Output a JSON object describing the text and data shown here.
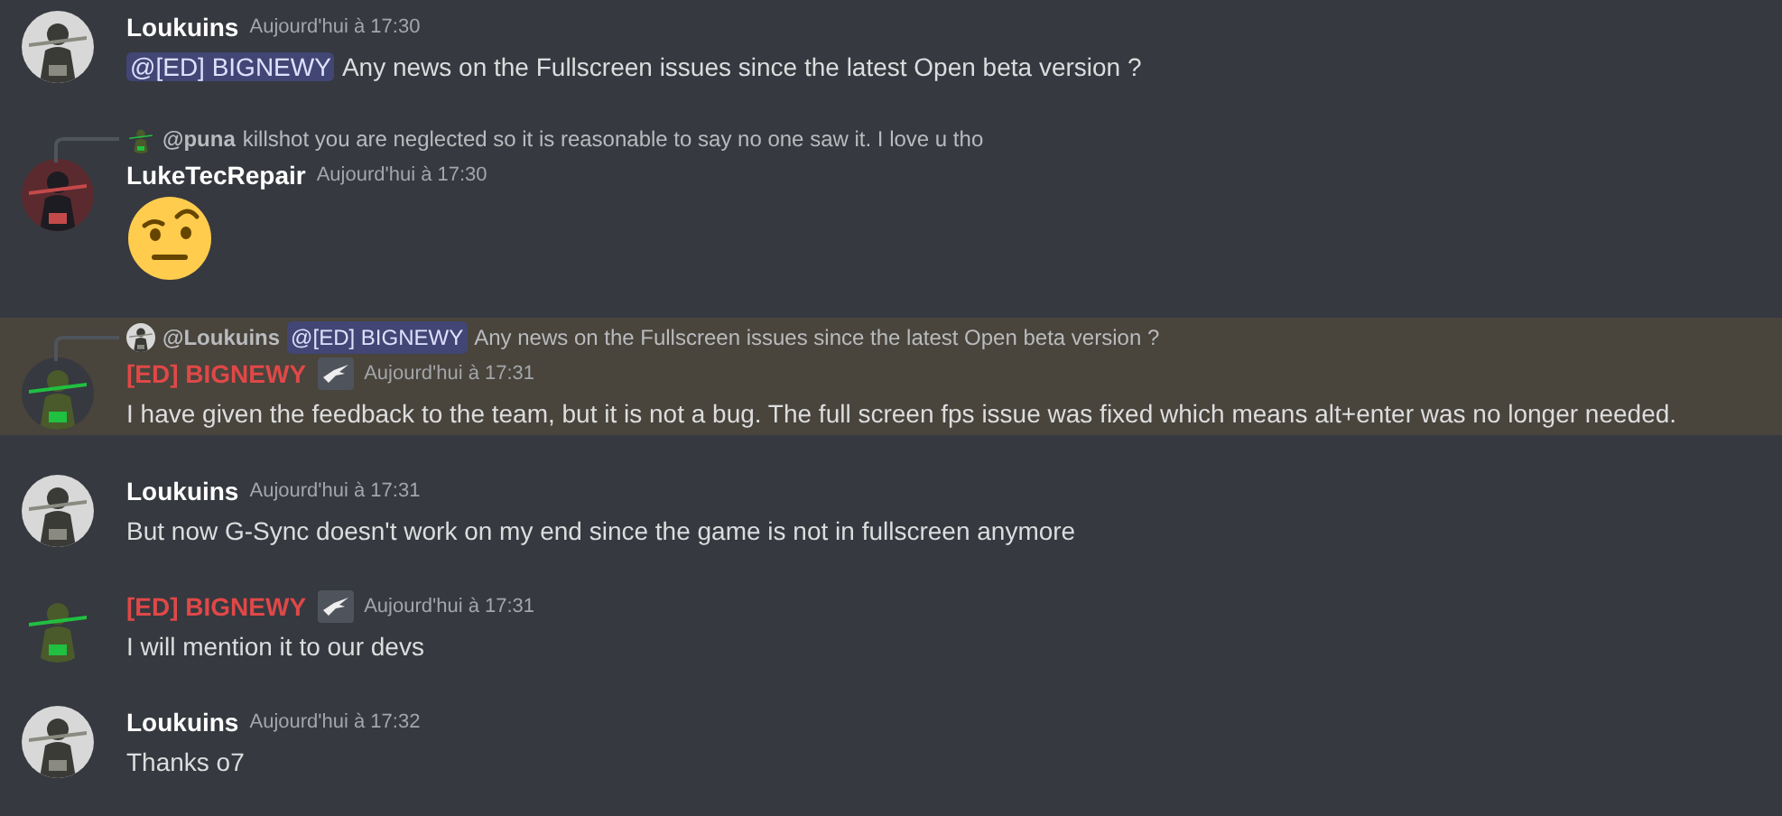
{
  "messages": [
    {
      "author": "Loukuins",
      "color": "#ffffff",
      "badge": false,
      "timestamp": "Aujourd'hui à 17:30",
      "highlighted": false,
      "content": [
        {
          "kind": "mention",
          "text": "@[ED] BIGNEWY"
        },
        {
          "kind": "text",
          "text": "Any news on the Fullscreen issues since the latest Open beta version ?"
        }
      ]
    },
    {
      "author": "LukeTecRepair",
      "color": "#ffffff",
      "badge": false,
      "timestamp": "Aujourd'hui à 17:30",
      "highlighted": false,
      "reply": {
        "author": "@puna",
        "content": [
          {
            "kind": "text",
            "text": "killshot you are neglected so it is reasonable to say no one saw it. I love u tho"
          }
        ]
      },
      "content": [
        {
          "kind": "emoji"
        }
      ]
    },
    {
      "author": "[ED] BIGNEWY",
      "color": "#e04848",
      "badge": true,
      "timestamp": "Aujourd'hui à 17:31",
      "highlighted": true,
      "reply": {
        "author": "@Loukuins",
        "content": [
          {
            "kind": "mention",
            "text": "@[ED] BIGNEWY"
          },
          {
            "kind": "text",
            "text": "Any news on the Fullscreen issues since the latest Open beta version ?"
          }
        ]
      },
      "content": [
        {
          "kind": "text",
          "text": "I have given the feedback to the team, but it is not a bug. The full screen fps issue was fixed which means alt+enter  was no longer needed."
        }
      ]
    },
    {
      "author": "Loukuins",
      "color": "#ffffff",
      "badge": false,
      "timestamp": "Aujourd'hui à 17:31",
      "highlighted": false,
      "content": [
        {
          "kind": "text",
          "text": "But now G-Sync doesn't work on my end since the game is not in fullscreen anymore"
        }
      ]
    },
    {
      "author": "[ED] BIGNEWY",
      "color": "#e04848",
      "badge": true,
      "timestamp": "Aujourd'hui à 17:31",
      "highlighted": false,
      "content": [
        {
          "kind": "text",
          "text": "I will mention it to our devs"
        }
      ]
    },
    {
      "author": "Loukuins",
      "color": "#ffffff",
      "badge": false,
      "timestamp": "Aujourd'hui à 17:32",
      "highlighted": false,
      "content": [
        {
          "kind": "text",
          "text": "Thanks o7"
        }
      ]
    }
  ]
}
